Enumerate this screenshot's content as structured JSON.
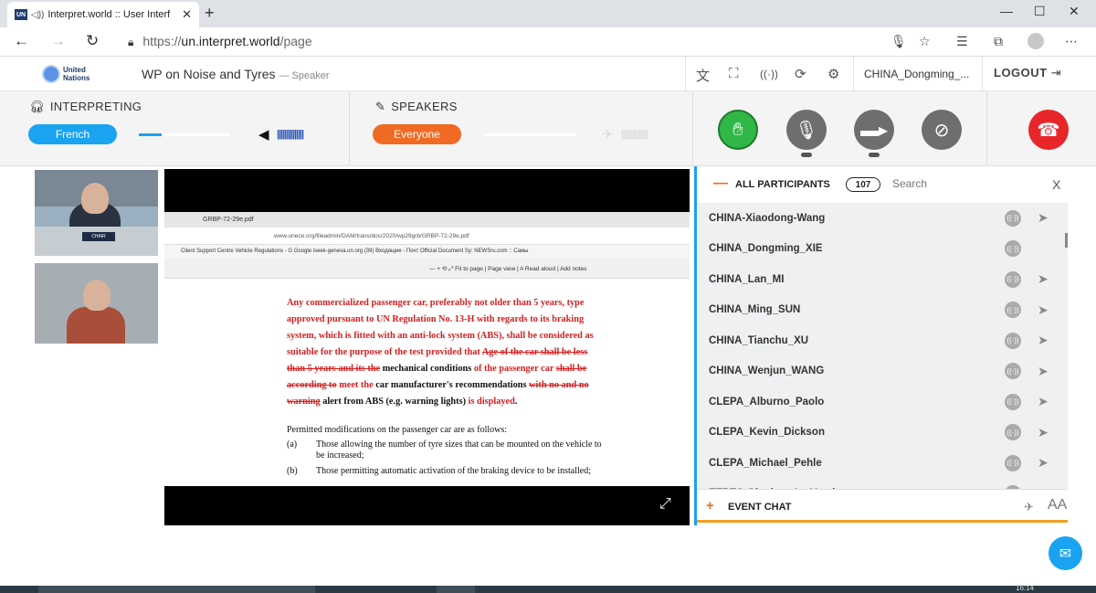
{
  "browser": {
    "tab_title": "Interpret.world :: User Interf",
    "tab_close": "✕",
    "new_tab": "+",
    "url_scheme": "https://",
    "url_host": "un.interpret.world",
    "url_path": "/page",
    "window_controls": [
      "—",
      "☐",
      "✕"
    ]
  },
  "header": {
    "org_line1": "United",
    "org_line2": "Nations",
    "meeting_title": "WP on Noise and Tyres",
    "role": "— Speaker",
    "user": "CHINA_Dongming_...",
    "logout": "LOGOUT"
  },
  "controls": {
    "interpreting_label": "INTERPRETING",
    "language": "French",
    "language_volume": 0.25,
    "speakers_label": "SPEAKERS",
    "speakers_target": "Everyone",
    "volume_bars": "||||||||||||||",
    "volume_bars_dim": "||||||||||||||"
  },
  "cameras": [
    {
      "name": "chair-camera",
      "plate": "CHAIR"
    },
    {
      "name": "speaker-camera"
    }
  ],
  "shared_screen": {
    "tab_title": "GRBP-72-29e.pdf",
    "url": "www.unece.org/fileadmin/DAM/trans/doc/2020/wp29grb/GRBP-72-29e.pdf",
    "bookmarks": "Client Support Centre   Vehicle Regulations -   G  Google   iseek-geneva.un.org   (39) Входящие - Почт   Official Document Sy:   NEWSru.com :: Самы",
    "pdf_toolbar": "—  +   ⟲   ⤢   Fit to page  |  Page view  |  A  Read aloud  |  Add notes",
    "para_red_1": "Any commercialized passenger car, preferably not older than 5 years, type approved pursuant to UN Regulation No. 13-H with regards to its braking system, which is fitted with an anti-lock system (ABS), shall be considered as suitable for the purpose of the test provided that ",
    "para_strike_1": "Age of the car shall be less than 5 years and its the",
    "para_black_1": " mechanical conditions ",
    "para_red_2": "of the passenger car ",
    "para_strike_2": "shall be according to",
    "para_red_3": " meet the ",
    "para_black_2": "car manufacturer's recommendations ",
    "para_strike_3": "with no and no warning",
    "para_black_3": " alert from ABS (e.g. warning lights) ",
    "para_red_4": "is displayed",
    "para_black_4": ".",
    "permitted": "Permitted modifications on the passenger car are as follows:",
    "items": [
      {
        "label": "(a)",
        "text": "Those allowing the number of tyre sizes that can be mounted on the vehicle to be increased;"
      },
      {
        "label": "(b)",
        "text": "Those permitting automatic activation of the braking device to be installed;"
      }
    ]
  },
  "participants": {
    "title": "ALL PARTICIPANTS",
    "count": "107",
    "search_placeholder": "Search",
    "close": "X",
    "list": [
      "CHINA-Xiaodong-Wang",
      "CHINA_Dongming_XIE",
      "CHINA_Lan_MI",
      "CHINA_Ming_SUN",
      "CHINA_Tianchu_XU",
      "CHINA_Wenjun_WANG",
      "CLEPA_Alburno_Paolo",
      "CLEPA_Kevin_Dickson",
      "CLEPA_Michael_Pehle",
      "ETRTO Gianluca Lo Vercio"
    ]
  },
  "chat": {
    "label": "EVENT CHAT",
    "font_toggle": "AA"
  },
  "taskbar": {
    "clock": "16:14"
  },
  "colors": {
    "accent_blue": "#1aa3f0",
    "accent_orange": "#f06a23",
    "mic_green": "#2fb847",
    "hangup_red": "#e8262a"
  }
}
